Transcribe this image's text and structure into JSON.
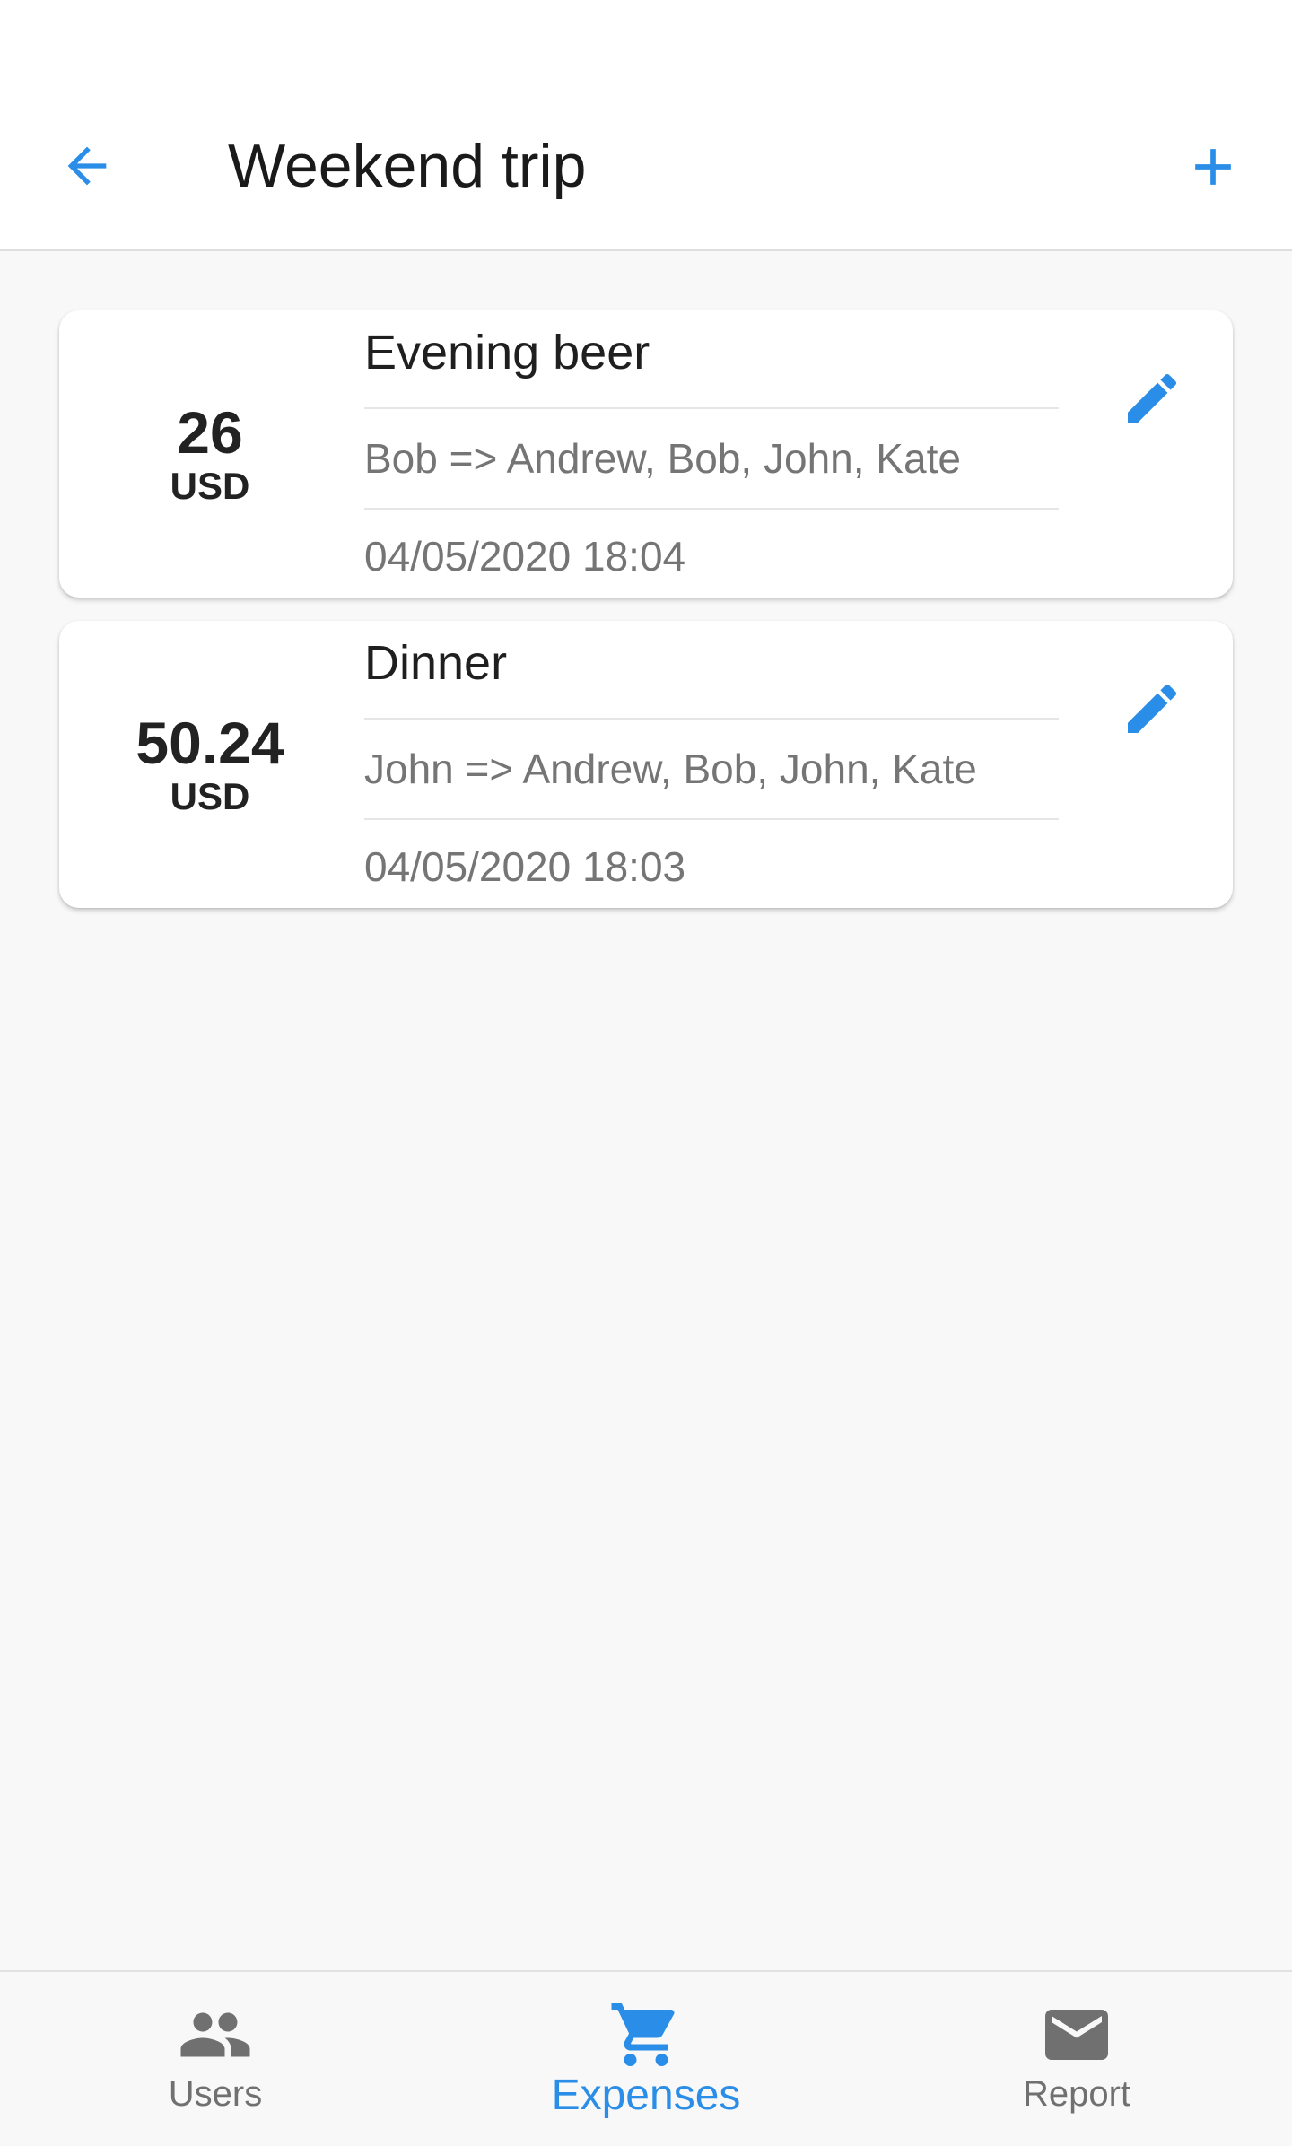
{
  "header": {
    "title": "Weekend trip",
    "back_icon": "arrow-back-icon",
    "add_icon": "plus-icon"
  },
  "expenses": [
    {
      "amount": "26",
      "currency": "USD",
      "title": "Evening beer",
      "members": "Bob => Andrew, Bob, John, Kate",
      "date": "04/05/2020 18:04",
      "edit_icon": "pencil-icon"
    },
    {
      "amount": "50.24",
      "currency": "USD",
      "title": "Dinner",
      "members": "John => Andrew, Bob, John, Kate",
      "date": "04/05/2020 18:03",
      "edit_icon": "pencil-icon"
    }
  ],
  "bottom_nav": {
    "items": [
      {
        "label": "Users",
        "icon": "users-icon",
        "active": false
      },
      {
        "label": "Expenses",
        "icon": "cart-icon",
        "active": true
      },
      {
        "label": "Report",
        "icon": "mail-icon",
        "active": false
      }
    ]
  },
  "colors": {
    "accent": "#2a8ee8",
    "background": "#f8f8f8",
    "card": "#ffffff",
    "text_primary": "#1f1f1f",
    "text_secondary": "#757575",
    "nav_inactive": "#707070"
  }
}
